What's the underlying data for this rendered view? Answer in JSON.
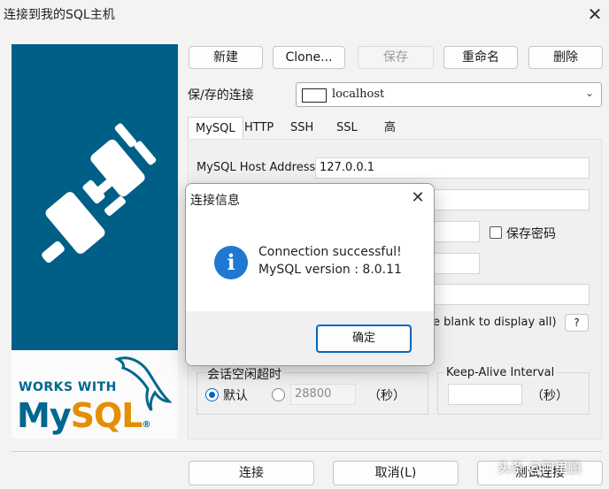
{
  "window": {
    "title": "连接到我的SQL主机"
  },
  "banner": {
    "works_with": "WORKS WITH",
    "logo_my": "My",
    "logo_sql": "SQL",
    "logo_mark": "®"
  },
  "toolbar": {
    "new_label": "新建",
    "clone_label": "Clone...",
    "save_label": "保存",
    "rename_label": "重命名",
    "delete_label": "删除"
  },
  "saved_connections": {
    "label": "保/存的连接",
    "selected": "localhost"
  },
  "tabs": [
    {
      "label": "MySQL",
      "active": true
    },
    {
      "label": "HTTP",
      "active": false
    },
    {
      "label": "SSH",
      "active": false
    },
    {
      "label": "SSL",
      "active": false
    },
    {
      "label": "高级功能",
      "active": false
    }
  ],
  "mysql_tab": {
    "host_label": "MySQL Host Address",
    "host_value": "127.0.0.1",
    "save_password_label": "保存密码",
    "databases_hint_tail": "e blank to display all)",
    "help_label": "?"
  },
  "idle_timeout": {
    "label": "会话空闲超时",
    "default_label": "默认",
    "custom_value": "28800",
    "unit": "（秒）",
    "default_selected": true
  },
  "keepalive": {
    "label": "Keep-Alive Interval",
    "unit": "（秒）"
  },
  "footer": {
    "connect_label": "连接",
    "cancel_label": "取消(L)",
    "test_label": "测试连接"
  },
  "dialog": {
    "title": "连接信息",
    "line1": "Connection successful!",
    "line2": "MySQL version : 8.0.11",
    "ok_label": "确定"
  },
  "watermark": "头条 @阿里鹏",
  "colors": {
    "banner": "#005f87",
    "accent": "#0067c0",
    "logo_blue": "#00678f",
    "logo_orange": "#e48e00"
  }
}
